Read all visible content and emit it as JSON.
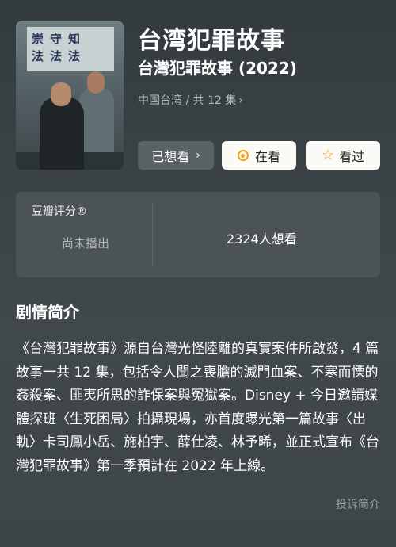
{
  "poster": {
    "sign_text": "崇守知\n法法法"
  },
  "header": {
    "title": "台湾犯罪故事",
    "original_title": "台灣犯罪故事 (2022)",
    "meta": "中国台湾 / 共 12 集",
    "meta_chevron": "›"
  },
  "actions": {
    "want_label": "已想看",
    "want_chevron": "›",
    "watching_label": "在看",
    "watched_label": "看过",
    "watching_icon": "circle-dot-icon",
    "watched_icon": "star-icon",
    "star_glyph": "☆"
  },
  "rating": {
    "label": "豆瓣评分®",
    "status": "尚未播出",
    "want_count": "2324人想看"
  },
  "synopsis": {
    "title": "剧情简介",
    "text": "《台灣犯罪故事》源自台灣光怪陸離的真實案件所啟發，4 篇故事一共 12 集，包括令人聞之喪膽的滅門血案、不寒而慄的姦殺案、匪夷所思的詐保案與冤獄案。Disney + 今日邀請媒體探班〈生死困局〉拍攝現場，亦首度曝光第一篇故事〈出軌〉卡司鳳小岳、施柏宇、薛仕凌、林予晞，並正式宣布《台灣犯罪故事》第一季預計在 2022 年上線。",
    "report_label": "投诉简介"
  },
  "colors": {
    "accent": "#f4a31c",
    "button_light": "#fbfaf6",
    "button_dark": "#5a6266",
    "card": "#4b5357"
  }
}
